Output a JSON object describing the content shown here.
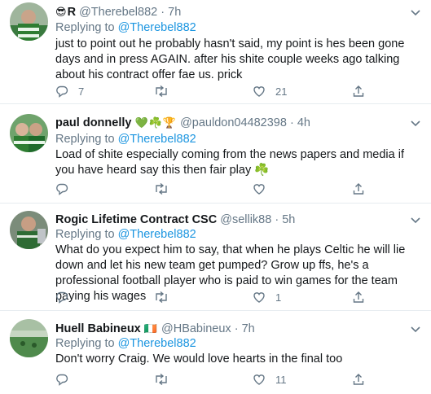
{
  "tweets": [
    {
      "name": "R",
      "name_emoji": "😎",
      "handle": "@Therebel882",
      "time": "7h",
      "replying_label": "Replying to",
      "replying_to": "@Therebel882",
      "text": "just to point out he probably hasn't said, my point is hes been gone days and in press AGAIN. after his shite couple weeks ago talking about his contract offer fae us. prick",
      "replies": "7",
      "retweets": "",
      "likes": "21",
      "colors": {
        "avatar": "#3a7a3f"
      }
    },
    {
      "name": "paul donnelly",
      "name_emoji": "💚☘️🏆",
      "handle": "@pauldon04482398",
      "time": "4h",
      "replying_label": "Replying to",
      "replying_to": "@Therebel882",
      "text": "Load of shite especially coming from the news papers and media if you have heard say this then fair play ☘️",
      "replies": "",
      "retweets": "",
      "likes": "",
      "colors": {
        "avatar": "#2f8a3c"
      }
    },
    {
      "name": "Rogic Lifetime Contract CSC",
      "name_emoji": "",
      "handle": "@sellik88",
      "time": "5h",
      "replying_label": "Replying to",
      "replying_to": "@Therebel882",
      "text": "What do you expect him to say, that when he plays Celtic he will lie down and let his new team get pumped? Grow up ffs, he's a professional football player who is paid to win games for the team paying his wages",
      "replies": "",
      "retweets": "",
      "likes": "1",
      "colors": {
        "avatar": "#486a4a"
      }
    },
    {
      "name": "Huell Babineux",
      "name_emoji": "🇮🇪",
      "handle": "@HBabineux",
      "time": "7h",
      "replying_label": "Replying to",
      "replying_to": "@Therebel882",
      "text": "Don't worry Craig.  We would love hearts in the final too",
      "replies": "",
      "retweets": "",
      "likes": "11",
      "colors": {
        "avatar": "#5f8a5a"
      }
    }
  ],
  "colors": {
    "link": "#1b95e0",
    "muted": "#657786",
    "divider": "#e6ecf0"
  }
}
